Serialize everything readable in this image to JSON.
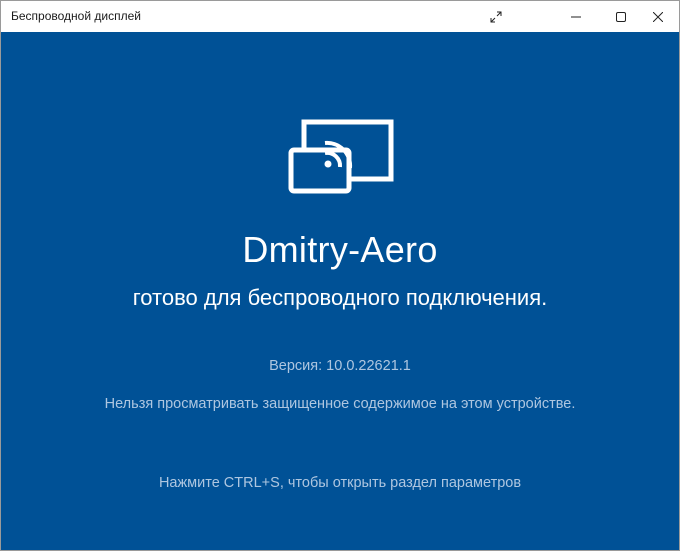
{
  "window": {
    "title": "Беспроводной дисплей",
    "accent_color": "#005196"
  },
  "titlebar": {
    "expand_icon": "expand-arrows-icon",
    "minimize_icon": "minimize-icon",
    "maximize_icon": "maximize-icon",
    "close_icon": "close-icon"
  },
  "main": {
    "icon": "wireless-display-cast-icon",
    "device_name": "Dmitry-Aero",
    "status": "готово для беспроводного подключения.",
    "version": "Версия: 10.0.22621.1",
    "protected_notice": "Нельзя просматривать защищенное содержимое на этом устройстве.",
    "settings_hint": "Нажмите CTRL+S, чтобы открыть раздел параметров"
  }
}
